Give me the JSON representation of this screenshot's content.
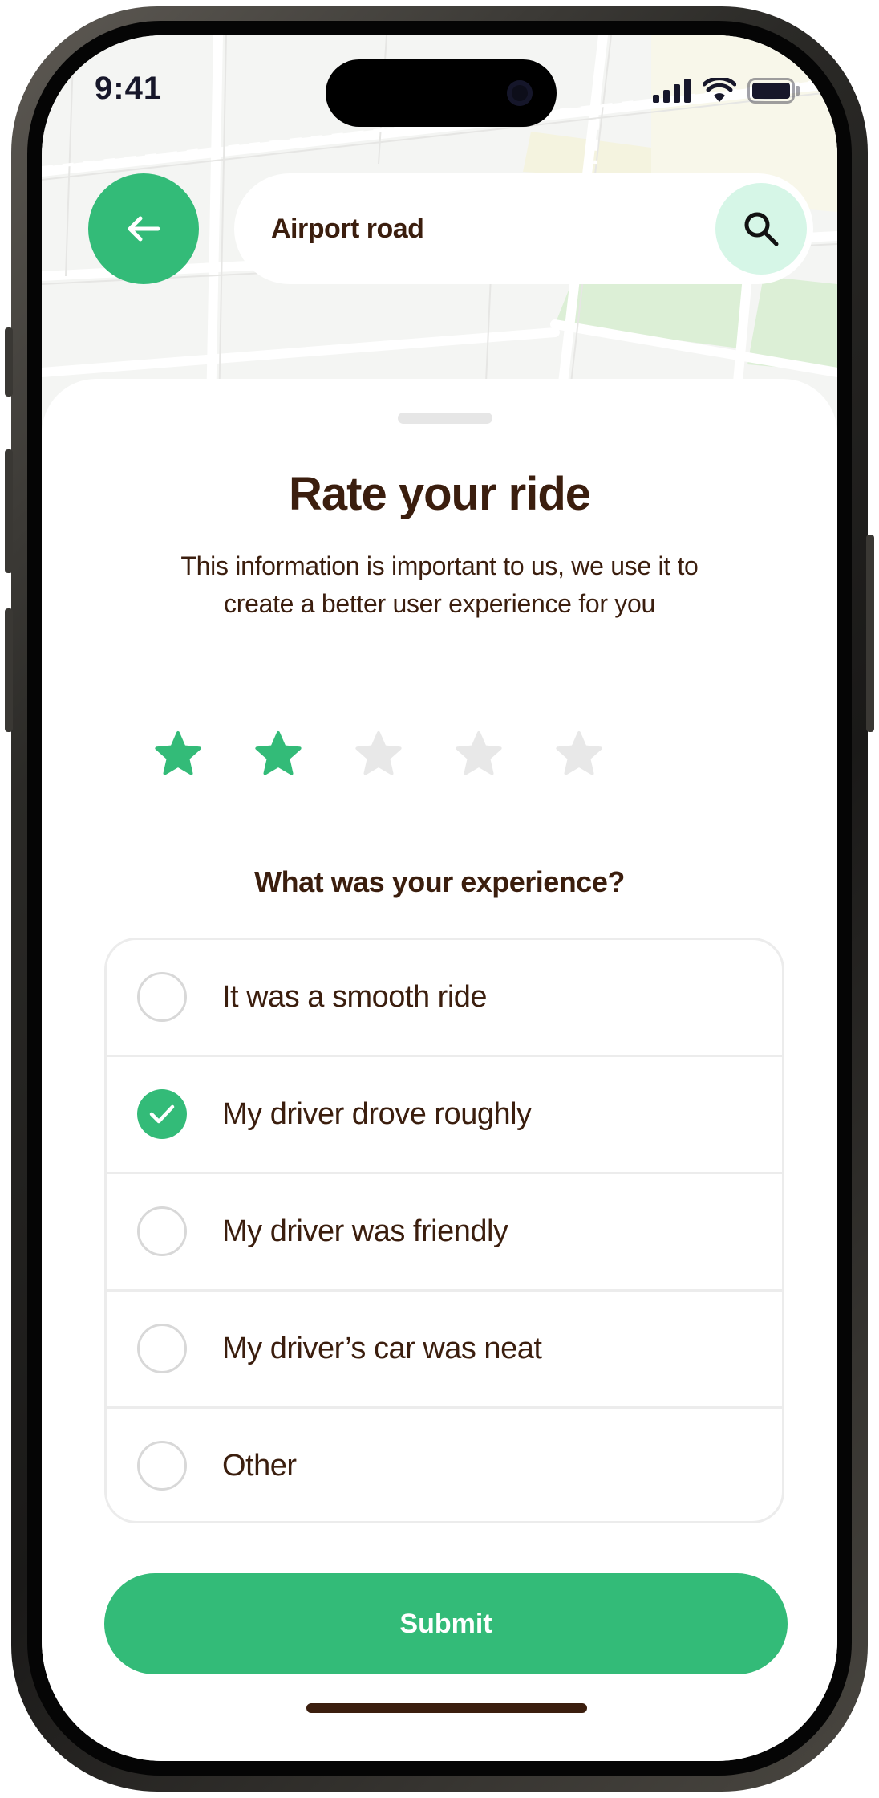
{
  "status_bar": {
    "time": "9:41"
  },
  "header": {
    "back_icon": "arrow-left-icon",
    "search_value": "Airport road",
    "search_icon": "search-icon"
  },
  "sheet": {
    "title": "Rate your ride",
    "subtitle": "This information is important to us, we use it to create a better user experience for you",
    "rating": {
      "value": 2,
      "max": 5
    },
    "question": "What was your experience?",
    "options": [
      {
        "label": "It was a smooth ride",
        "selected": false
      },
      {
        "label": "My driver drove roughly",
        "selected": true
      },
      {
        "label": "My driver was friendly",
        "selected": false
      },
      {
        "label": "My driver’s car was neat",
        "selected": false
      },
      {
        "label": "Other",
        "selected": false
      }
    ],
    "submit_label": "Submit"
  },
  "colors": {
    "accent": "#33bb78",
    "accent_light": "#d6f6e7",
    "text": "#3b1e0e",
    "star_empty": "#e8e8e8"
  }
}
